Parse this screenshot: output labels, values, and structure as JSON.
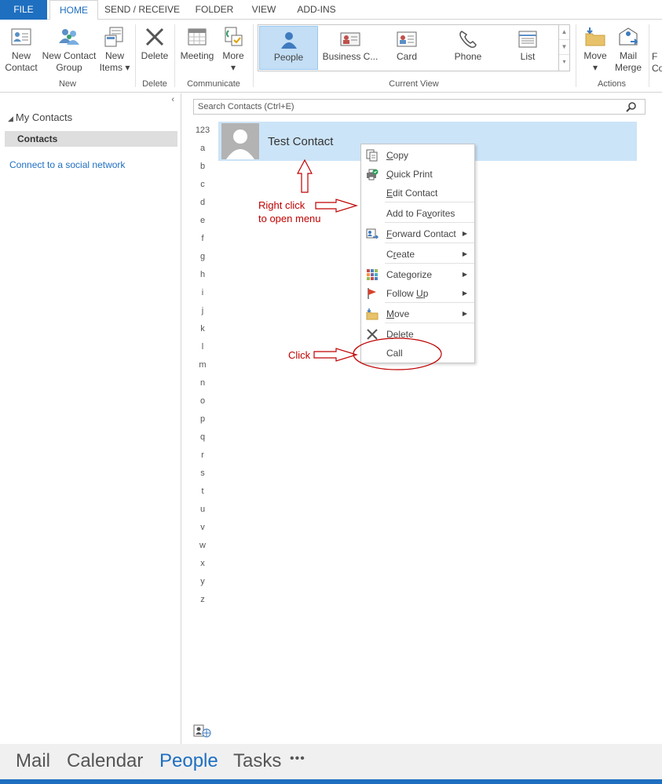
{
  "tabs": {
    "file": "FILE",
    "home": "HOME",
    "send_receive": "SEND / RECEIVE",
    "folder": "FOLDER",
    "view": "VIEW",
    "add_ins": "ADD-INS"
  },
  "ribbon": {
    "new_contact": [
      "New",
      "Contact"
    ],
    "new_contact_group": [
      "New Contact",
      "Group"
    ],
    "new_items": [
      "New",
      "Items ▾"
    ],
    "delete": "Delete",
    "meeting": "Meeting",
    "more": [
      "More",
      "▾"
    ],
    "view_people": "People",
    "view_business_card": "Business C...",
    "view_card": "Card",
    "view_phone": "Phone",
    "view_list": "List",
    "move": [
      "Move",
      "▾"
    ],
    "mail_merge": [
      "Mail",
      "Merge"
    ],
    "cut_off": [
      "F",
      "Co"
    ],
    "groups": {
      "new": "New",
      "delete": "Delete",
      "communicate": "Communicate",
      "current_view": "Current View",
      "actions": "Actions"
    }
  },
  "leftnav": {
    "collapse": "‹",
    "my_contacts": "My Contacts",
    "contacts": "Contacts",
    "social": "Connect to a social network"
  },
  "search": {
    "placeholder": "Search Contacts (Ctrl+E)"
  },
  "alphabet": [
    "123",
    "a",
    "b",
    "c",
    "d",
    "e",
    "f",
    "g",
    "h",
    "i",
    "j",
    "k",
    "l",
    "m",
    "n",
    "o",
    "p",
    "q",
    "r",
    "s",
    "t",
    "u",
    "v",
    "w",
    "x",
    "y",
    "z"
  ],
  "contact": {
    "name": "Test Contact"
  },
  "context_menu": [
    {
      "pre": "",
      "u": "C",
      "post": "opy",
      "icon": "copy-icon",
      "submenu": false
    },
    {
      "pre": "",
      "u": "Q",
      "post": "uick Print",
      "icon": "quick-print-icon",
      "submenu": false
    },
    {
      "pre": "",
      "u": "E",
      "post": "dit Contact",
      "icon": "",
      "submenu": false
    },
    {
      "pre": "Add to Fa",
      "u": "v",
      "post": "orites",
      "icon": "",
      "submenu": false
    },
    {
      "pre": "",
      "u": "F",
      "post": "orward Contact",
      "icon": "forward-contact-icon",
      "submenu": true
    },
    {
      "pre": "C",
      "u": "r",
      "post": "eate",
      "icon": "",
      "submenu": true
    },
    {
      "pre": "Cate",
      "u": "g",
      "post": "orize",
      "icon": "categorize-icon",
      "submenu": true
    },
    {
      "pre": "Follow ",
      "u": "U",
      "post": "p",
      "icon": "follow-up-flag-icon",
      "submenu": true
    },
    {
      "pre": "",
      "u": "M",
      "post": "ove",
      "icon": "move-folder-icon",
      "submenu": true
    },
    {
      "pre": "",
      "u": "D",
      "post": "elete",
      "icon": "delete-x-icon",
      "submenu": false
    },
    {
      "pre": "Call",
      "u": "",
      "post": "",
      "icon": "",
      "submenu": false
    }
  ],
  "annotations": {
    "right_click": [
      "Right click",
      "to open menu"
    ],
    "click": "Click"
  },
  "bottom_nav": {
    "mail": "Mail",
    "calendar": "Calendar",
    "people": "People",
    "tasks": "Tasks",
    "more": "•••"
  },
  "colors": {
    "accent": "#1e6fc0",
    "selected_card": "#cce4f7",
    "annotation": "#c00000"
  }
}
